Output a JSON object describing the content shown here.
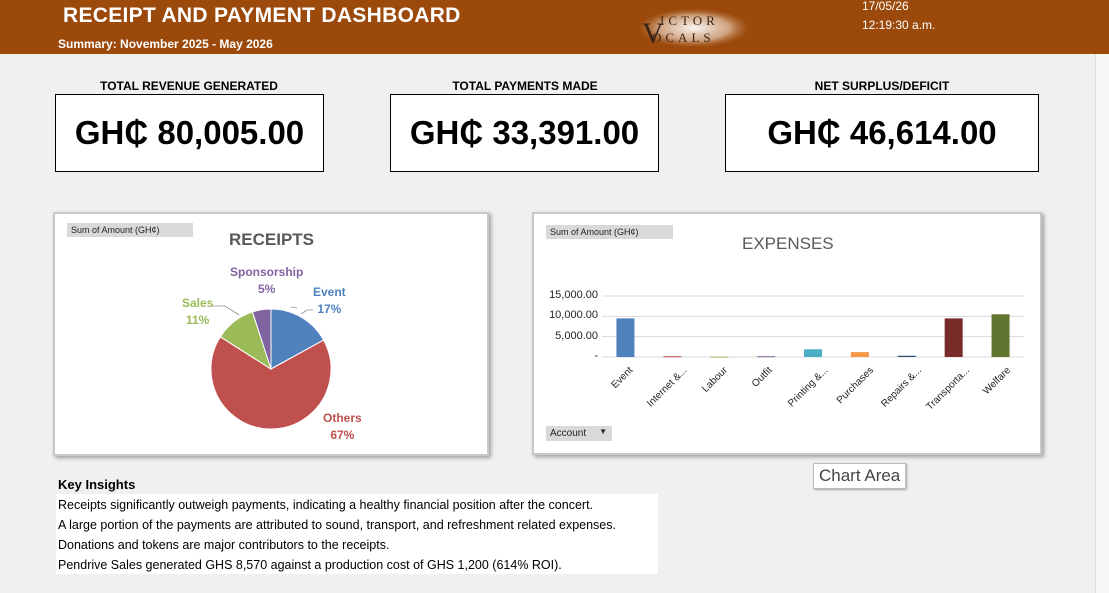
{
  "header": {
    "title": "RECEIPT AND PAYMENT DASHBOARD",
    "subtitle": "Summary: November 2025 - May 2026",
    "logo_text": "VICTOR VOCALS",
    "date": "17/05/26",
    "time": "12:19:30 a.m."
  },
  "kpis": [
    {
      "label": "TOTAL REVENUE GENERATED",
      "value": "GH₵ 80,005.00"
    },
    {
      "label": "TOTAL PAYMENTS MADE",
      "value": "GH₵ 33,391.00"
    },
    {
      "label": "NET SURPLUS/DEFICIT",
      "value": "GH₵ 46,614.00"
    }
  ],
  "receipts_chart": {
    "field_button": "Sum of Amount (GH¢)",
    "title": "RECEIPTS"
  },
  "expenses_chart": {
    "field_button": "Sum of Amount (GH¢)",
    "title": "EXPENSES",
    "filter_button": "Account",
    "filter_icon": "dropdown-arrow-icon"
  },
  "chart_area_tooltip": "Chart Area",
  "chart_data": [
    {
      "type": "pie",
      "title": "RECEIPTS",
      "categories": [
        "Event",
        "Others",
        "Sales",
        "Sponsorship"
      ],
      "values": [
        17,
        67,
        11,
        5
      ],
      "labels": [
        "17%",
        "67%",
        "11%",
        "5%"
      ],
      "colors": [
        "#4f81bd",
        "#c0504d",
        "#9bbb59",
        "#8064a2"
      ]
    },
    {
      "type": "bar",
      "title": "EXPENSES",
      "categories": [
        "Event",
        "Internet &...",
        "Labour",
        "Outfit",
        "Printing &...",
        "Purchases",
        "Repairs &...",
        "Transporta...",
        "Welfare"
      ],
      "values": [
        9500,
        200,
        100,
        200,
        1900,
        1200,
        300,
        9500,
        10500
      ],
      "colors": [
        "#4f81bd",
        "#c0504d",
        "#9bbb59",
        "#8064a2",
        "#4bacc6",
        "#f79646",
        "#2c4d75",
        "#772c2a",
        "#5f7530"
      ],
      "yticks": [
        "15,000.00",
        "10,000.00",
        "5,000.00",
        "-"
      ],
      "ylim": [
        0,
        15000
      ],
      "grid": true
    }
  ],
  "insights": {
    "title": "Key Insights",
    "lines": [
      "Receipts significantly outweigh payments, indicating a healthy financial position after the concert.",
      "A large portion of the payments are attributed to sound, transport, and refreshment related expenses.",
      "Donations and tokens are major contributors to the receipts.",
      "Pendrive Sales generated GHS 8,570 against a production cost of GHS 1,200 (614% ROI)."
    ]
  }
}
